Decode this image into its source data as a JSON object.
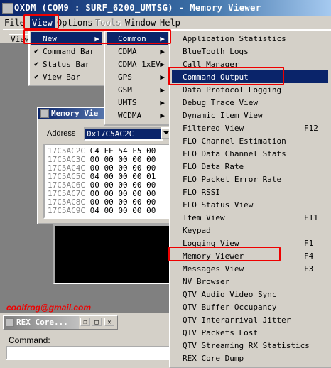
{
  "window": {
    "title": "QXDM (COM9 : SURF_6200_UMTSG) - Memory Viewer"
  },
  "menubar": {
    "items": [
      "File",
      "View",
      "Options",
      "Tools",
      "Window",
      "Help"
    ]
  },
  "workspace": {
    "tab_label": "View"
  },
  "view_menu": {
    "items": [
      {
        "label": "New",
        "checked": false,
        "has_submenu": true
      },
      {
        "label": "Command Bar",
        "checked": true,
        "has_submenu": false
      },
      {
        "label": "Status Bar",
        "checked": true,
        "has_submenu": false
      },
      {
        "label": "View Bar",
        "checked": true,
        "has_submenu": false
      }
    ]
  },
  "new_submenu": {
    "items": [
      "Common",
      "CDMA",
      "CDMA 1xEV",
      "GPS",
      "GSM",
      "UMTS",
      "WCDMA"
    ]
  },
  "common_submenu": {
    "items": [
      {
        "label": "Application Statistics",
        "shortcut": ""
      },
      {
        "label": "BlueTooth Logs",
        "shortcut": ""
      },
      {
        "label": "Call Manager",
        "shortcut": ""
      },
      {
        "label": "Command Output",
        "shortcut": ""
      },
      {
        "label": "Data Protocol Logging",
        "shortcut": ""
      },
      {
        "label": "Debug Trace View",
        "shortcut": ""
      },
      {
        "label": "Dynamic Item View",
        "shortcut": ""
      },
      {
        "label": "Filtered View",
        "shortcut": "F12"
      },
      {
        "label": "FLO Channel Estimation",
        "shortcut": ""
      },
      {
        "label": "FLO Data Channel Stats",
        "shortcut": ""
      },
      {
        "label": "FLO Data Rate",
        "shortcut": ""
      },
      {
        "label": "FLO Packet Error Rate",
        "shortcut": ""
      },
      {
        "label": "FLO RSSI",
        "shortcut": ""
      },
      {
        "label": "FLO Status View",
        "shortcut": ""
      },
      {
        "label": "Item View",
        "shortcut": "F11"
      },
      {
        "label": "Keypad",
        "shortcut": ""
      },
      {
        "label": "Logging View",
        "shortcut": "F1"
      },
      {
        "label": "Memory Viewer",
        "shortcut": "F4"
      },
      {
        "label": "Messages View",
        "shortcut": "F3"
      },
      {
        "label": "NV Browser",
        "shortcut": ""
      },
      {
        "label": "QTV Audio Video Sync",
        "shortcut": ""
      },
      {
        "label": "QTV Buffer Occupancy",
        "shortcut": ""
      },
      {
        "label": "QTV Interarrival Jitter",
        "shortcut": ""
      },
      {
        "label": "QTV Packets Lost",
        "shortcut": ""
      },
      {
        "label": "QTV Streaming RX Statistics",
        "shortcut": ""
      },
      {
        "label": "REX Core Dump",
        "shortcut": ""
      }
    ]
  },
  "memory_viewer": {
    "title": "Memory Vie",
    "address_label": "Address",
    "address_value": "0x17C5AC2C",
    "rows": [
      {
        "addr": "17C5AC2C",
        "bytes": "C4 FE 54 F5 00"
      },
      {
        "addr": "17C5AC3C",
        "bytes": "00 00 00 00 00"
      },
      {
        "addr": "17C5AC4C",
        "bytes": "00 00 00 00 00"
      },
      {
        "addr": "17C5AC5C",
        "bytes": "04 00 00 00 01"
      },
      {
        "addr": "17C5AC6C",
        "bytes": "00 00 00 00 00"
      },
      {
        "addr": "17C5AC7C",
        "bytes": "00 00 00 00 00"
      },
      {
        "addr": "17C5AC8C",
        "bytes": "00 00 00 00 00"
      },
      {
        "addr": "17C5AC9C",
        "bytes": "04 00 00 00 00"
      }
    ]
  },
  "rex_window": {
    "title": "REX Core..."
  },
  "command": {
    "label": "Command:"
  },
  "credit": "coolfrog@gmail.com",
  "colors": {
    "highlight": "#0a246a",
    "annotation": "#e00000",
    "credit": "#e00000"
  }
}
